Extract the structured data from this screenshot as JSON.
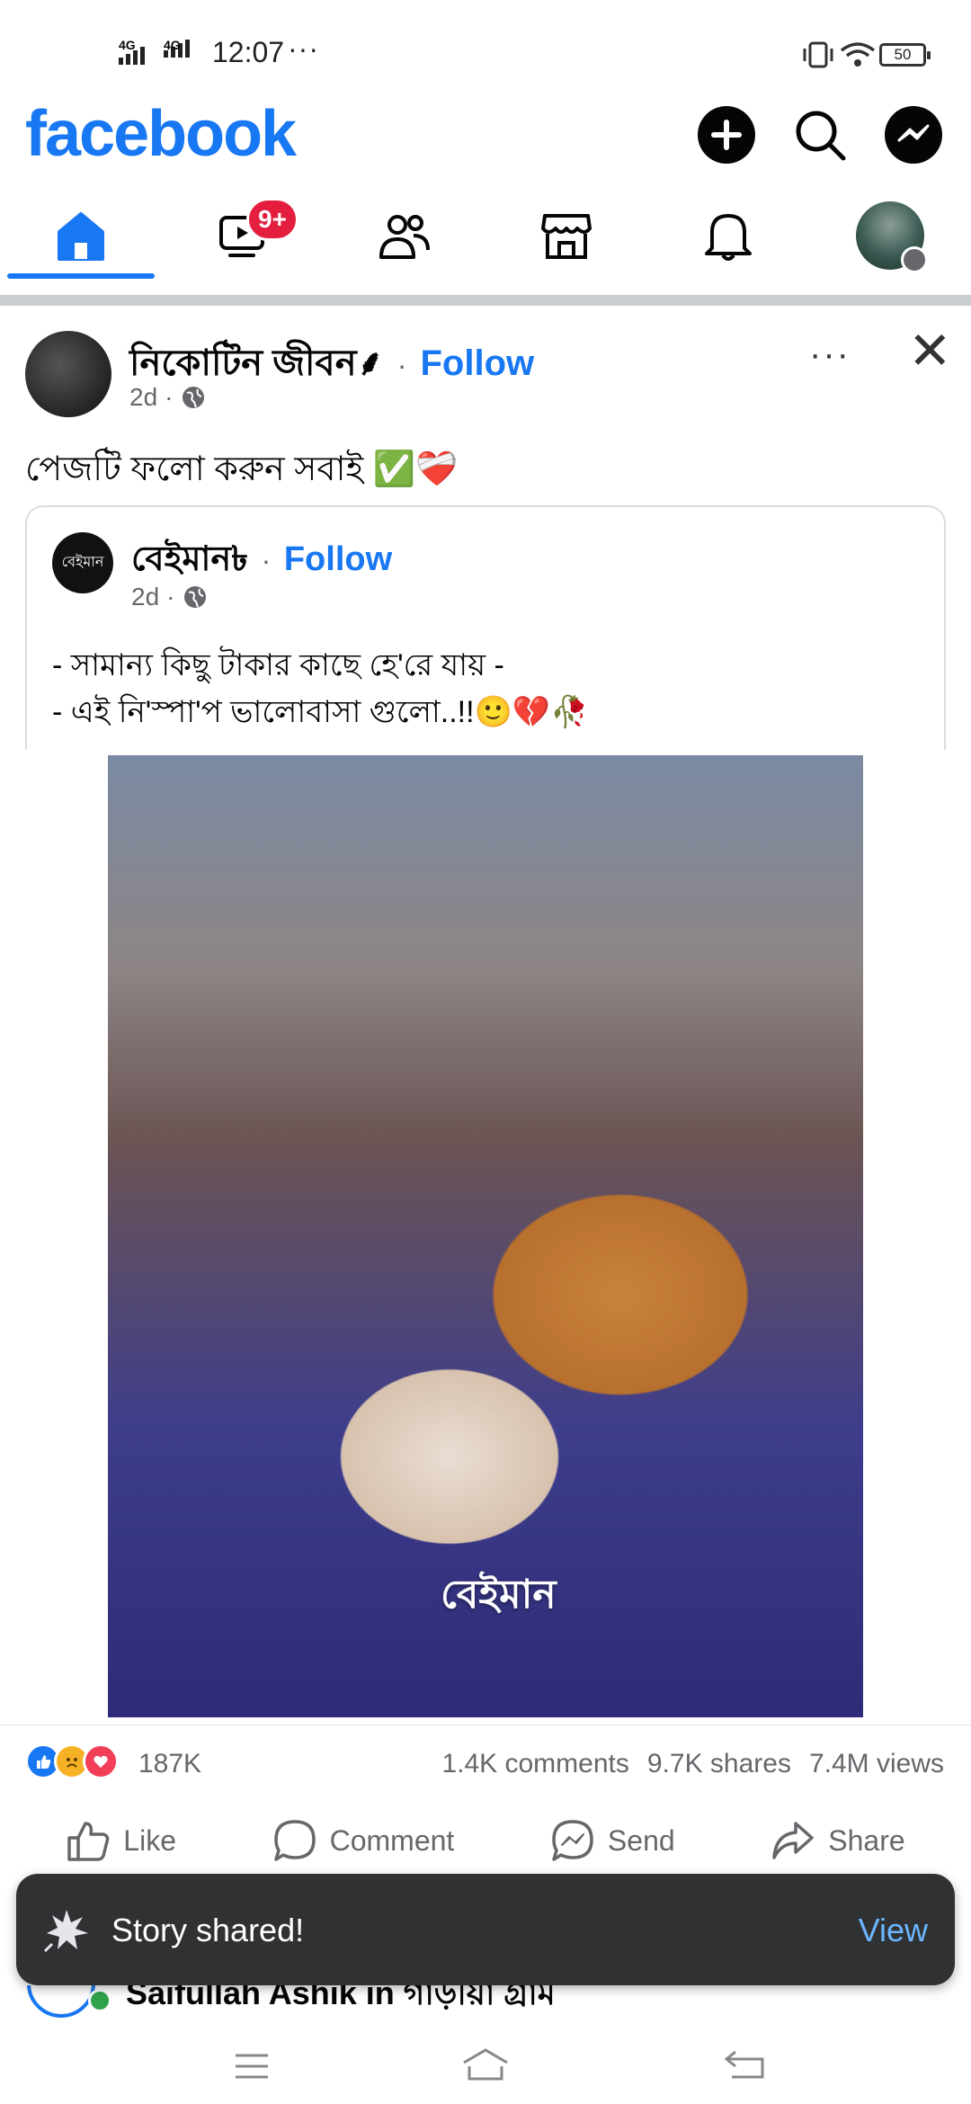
{
  "status_bar": {
    "network_1": "4G",
    "network_2": "4G",
    "time": "12:07",
    "more": "···",
    "battery": "50"
  },
  "header": {
    "logo": "facebook"
  },
  "nav": {
    "notifications_badge": "9+"
  },
  "post": {
    "author": "নিকোটিন জীবন⸙",
    "follow": "Follow",
    "dot": "·",
    "time": "2d",
    "more": "···",
    "close": "✕",
    "text": "পেজটি ফলো করুন সবাই ✅❤️‍🩹",
    "shared": {
      "avatar_text": "বেইমান",
      "author": "বেইমান৳",
      "follow": "Follow",
      "time": "2d",
      "line1": "- সামান্য কিছু টাকার কাছে হে'রে যায় -",
      "line2": "- এই নি'স্পা'প ভালোবাসা গুলো..!!🙂💔🥀"
    },
    "media_watermark": "বেইমান"
  },
  "stats": {
    "reactions_count": "187K",
    "comments": "1.4K comments",
    "shares": "9.7K shares",
    "views": "7.4M views"
  },
  "actions": {
    "like": "Like",
    "comment": "Comment",
    "send": "Send",
    "share": "Share"
  },
  "toast": {
    "message": "Story shared!",
    "action": "View"
  },
  "peek": {
    "text": "Saifullah Ashik in গাড়ীয়া গ্রাম"
  },
  "colors": {
    "brand": "#1877f2",
    "badge": "#e41e3f",
    "toast_bg": "#303133",
    "toast_link": "#6bb6ff"
  }
}
